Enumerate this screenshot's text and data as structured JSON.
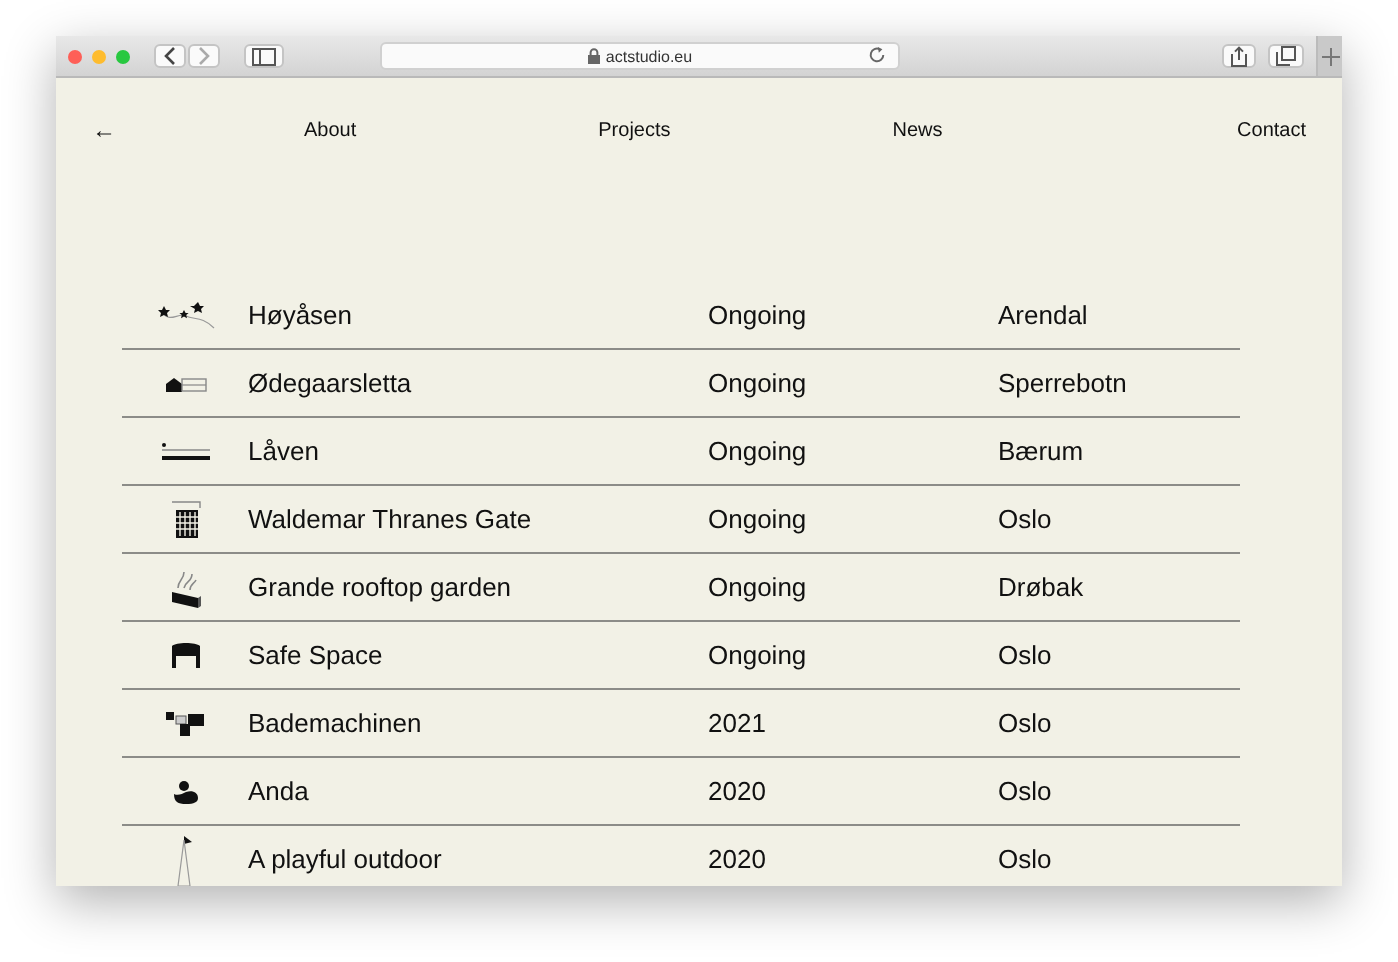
{
  "browser": {
    "url": "actstudio.eu"
  },
  "nav": {
    "back": "←",
    "links": [
      "About",
      "Projects",
      "News",
      "Contact"
    ]
  },
  "projects": [
    {
      "name": "Høyåsen",
      "status": "Ongoing",
      "location": "Arendal"
    },
    {
      "name": "Ødegaarsletta",
      "status": "Ongoing",
      "location": "Sperrebotn"
    },
    {
      "name": "Låven",
      "status": "Ongoing",
      "location": "Bærum"
    },
    {
      "name": "Waldemar Thranes Gate",
      "status": "Ongoing",
      "location": "Oslo"
    },
    {
      "name": "Grande rooftop garden",
      "status": "Ongoing",
      "location": "Drøbak"
    },
    {
      "name": "Safe Space",
      "status": "Ongoing",
      "location": "Oslo"
    },
    {
      "name": "Bademachinen",
      "status": "2021",
      "location": "Oslo"
    },
    {
      "name": "Anda",
      "status": "2020",
      "location": "Oslo"
    },
    {
      "name": "A playful outdoor",
      "status": "2020",
      "location": "Oslo"
    }
  ]
}
